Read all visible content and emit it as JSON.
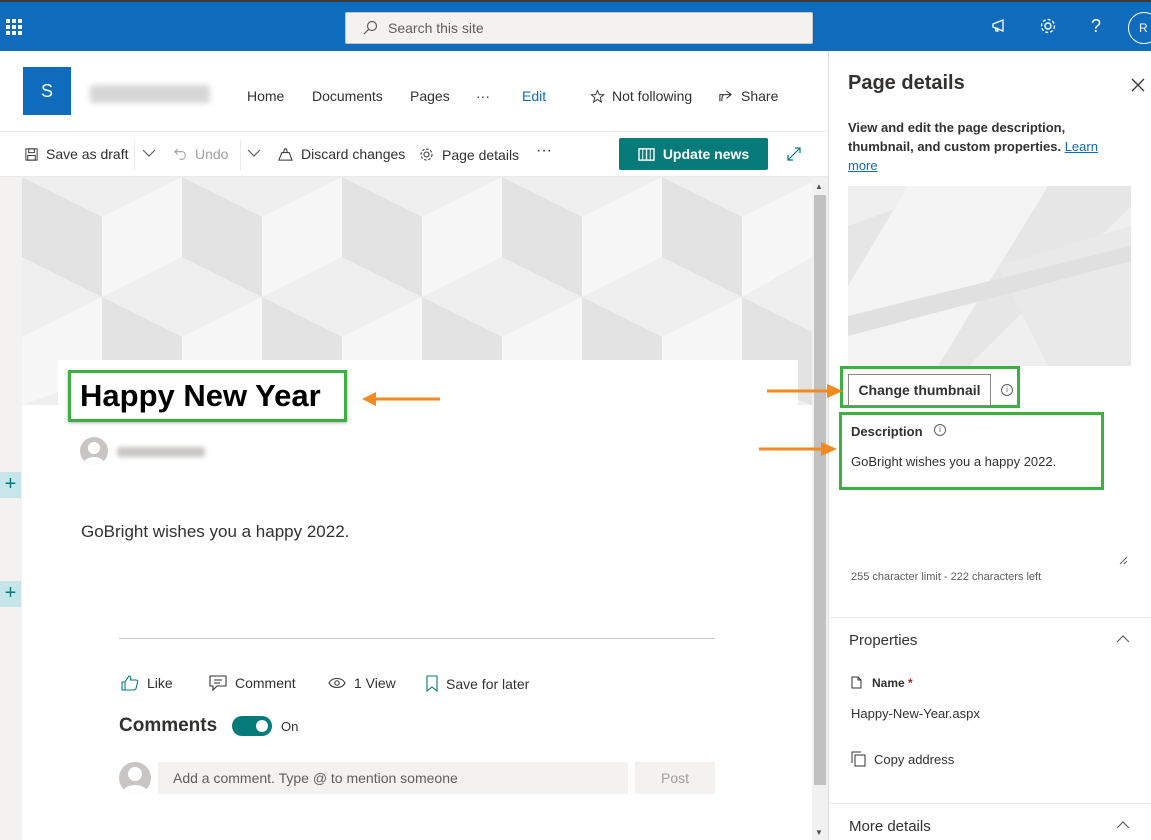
{
  "suitebar": {
    "search_placeholder": "Search this site",
    "avatar_initial": "R"
  },
  "site": {
    "logo_letter": "S",
    "nav": [
      "Home",
      "Documents",
      "Pages",
      "···",
      "Edit"
    ],
    "follow_label": "Not following",
    "share_label": "Share"
  },
  "commandbar": {
    "save_draft": "Save as draft",
    "undo": "Undo",
    "discard": "Discard changes",
    "page_details": "Page details",
    "more": "···",
    "update_news": "Update news"
  },
  "page": {
    "title": "Happy New Year",
    "body": "GoBright wishes you a happy 2022.",
    "social": {
      "like": "Like",
      "comment": "Comment",
      "views": "1 View",
      "save_later": "Save for later"
    },
    "comments_label": "Comments",
    "comments_toggle": "On",
    "comment_placeholder": "Add a comment. Type @ to mention someone",
    "post_label": "Post"
  },
  "panel": {
    "title": "Page details",
    "description_intro": "View and edit the page description, thumbnail, and custom properties.",
    "learn_more": "Learn more",
    "change_thumbnail": "Change thumbnail",
    "description_label": "Description",
    "description_value": "GoBright wishes you a happy 2022.",
    "char_limit": "255 character limit - 222 characters left",
    "properties_title": "Properties",
    "name_label": "Name",
    "name_required": "*",
    "name_value": "Happy-New-Year.aspx",
    "copy_address": "Copy address",
    "more_details": "More details"
  },
  "colors": {
    "brand_blue": "#0f6cbd",
    "teal": "#077a7a",
    "highlight_green": "#3cb043",
    "annotation_orange": "#f28a1f"
  }
}
